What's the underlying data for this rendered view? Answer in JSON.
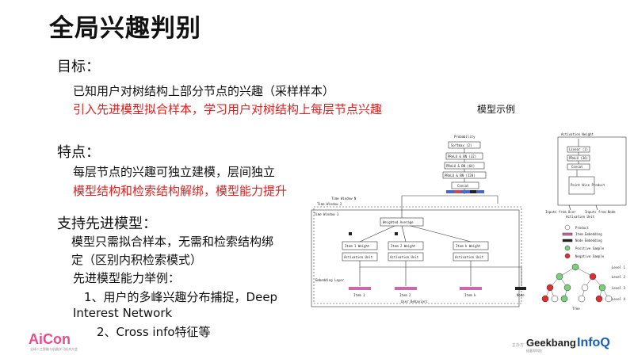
{
  "title": "全局兴趣判别",
  "section1": {
    "heading": "目标：",
    "line1": "已知用户对树结构上部分节点的兴趣（采样样本）",
    "line2": "引入先进模型拟合样本，学习用户对树结构上每层节点兴趣"
  },
  "caption": "模型示例",
  "section2": {
    "heading": "特点：",
    "line1": "每层节点的兴趣可独立建模，层间独立",
    "line2": "模型结构和检索结构解绑，模型能力提升"
  },
  "section3": {
    "heading": "支持先进模型：",
    "line1": "模型只需拟合样本，无需和检索结构绑",
    "line2": "定（区别内积检索模式）",
    "line3": "先进模型能力举例：",
    "line4": "1、用户的多峰兴趣分布捕捉，Deep",
    "line5": "Interest Network",
    "line6": "2、Cross info特征等"
  },
  "diagram": {
    "probability": "Probability",
    "softmax": "Softmax (2)",
    "layer1": "PReLU & BN (32)",
    "layer2": "PReLU & BN (64)",
    "layer3": "PReLU & BN (128)",
    "concat": "Concat",
    "time_window_n": "Time Window N",
    "time_window_2": "Time Window 2",
    "time_window_1": "Time Window 1",
    "weighted_average": "Weighted Average",
    "item1_weight": "Item 1 Weight",
    "item2_weight": "Item 2 Weight",
    "itemk_weight": "Item k Weight",
    "activation_unit": "Activation Unit",
    "embedding_layer": "Embedding Layer",
    "item1": "Item 1",
    "item2": "Item 2",
    "itemk": "Item k",
    "user_behaviors": "User Behaviors",
    "node": "Node",
    "au_title": "Activation Weight",
    "au_linear": "Linear (1)",
    "au_prelu1": "PReLU (36)",
    "au_concat": "Concat",
    "au_product": "Point Wise Product",
    "au_in1": "Inputs from User",
    "au_in2": "Inputs from Node",
    "au_caption": "Activation Unit",
    "legend_product": "Product",
    "legend_item": "Item Embedding",
    "legend_node": "Node Embedding",
    "legend_pos": "Positive Sample",
    "legend_neg": "Negative Sample",
    "tree_caption": "Tree",
    "levels": [
      "Level 1",
      "Level 2",
      "Level 3",
      "Level 4"
    ]
  },
  "footer": {
    "aicon": "AiCon",
    "aicon_sub": "全球人工智能与机器学习技术大会",
    "sponsor": "主办方",
    "geekbang": "Geekbang",
    "geek_sub": "极客邦科技",
    "infoq": "InfoQ"
  }
}
